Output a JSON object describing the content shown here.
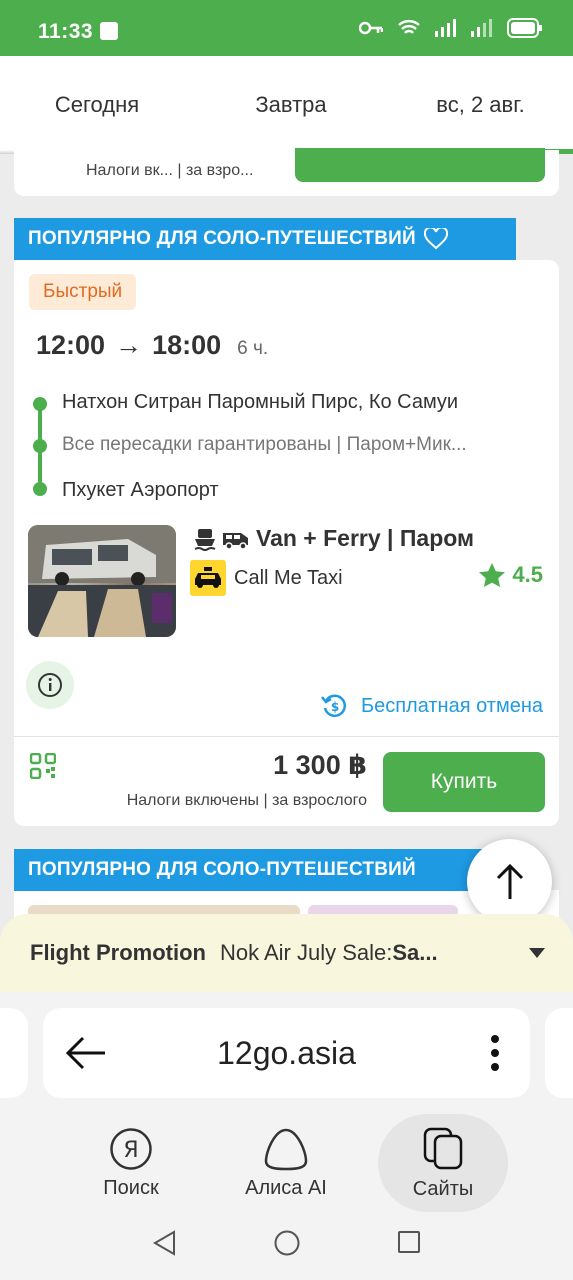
{
  "status_bar": {
    "time": "11:33"
  },
  "date_tabs": [
    {
      "label": "Сегодня"
    },
    {
      "label": "Завтра"
    },
    {
      "label": "вс, 2 авг."
    }
  ],
  "prev_card": {
    "tax_note": "Налоги вк... | за взро..."
  },
  "ribbon": {
    "label": "ПОПУЛЯРНО ДЛЯ СОЛО-ПУТЕШЕСТВИЙ"
  },
  "trip": {
    "badge": "Быстрый",
    "depart": "12:00",
    "arrive": "18:00",
    "arrow": "→",
    "duration": "6 ч.",
    "stops": [
      "Натхон Ситран Паромный Пирс, Ко Самуи",
      "Все пересадки гарантированы | Паром+Мик...",
      "Пхукет Аэропорт"
    ],
    "vehicle": "Van + Ferry | Паром",
    "operator": "Call Me Taxi",
    "rating": "4.5",
    "free_cancel": "Бесплатная отмена",
    "price": "1 300 ฿",
    "price_note": "Налоги включены | за взрослого",
    "buy_label": "Купить"
  },
  "next_ribbon": {
    "label": "ПОПУЛЯРНО ДЛЯ СОЛО-ПУТЕШЕСТВИЙ"
  },
  "promo": {
    "label": "Flight Promotion",
    "text": "Nok Air July Sale: ",
    "sale": "Sa..."
  },
  "browser": {
    "url": "12go.asia",
    "nav": [
      {
        "label": "Поиск",
        "icon": "yandex-icon"
      },
      {
        "label": "Алиса AI",
        "icon": "alice-icon"
      },
      {
        "label": "Сайты",
        "icon": "tabs-icon"
      }
    ]
  },
  "colors": {
    "accent": "#4cae4c",
    "ribbon": "#1e9ae3",
    "badge_text": "#e26b1f"
  }
}
